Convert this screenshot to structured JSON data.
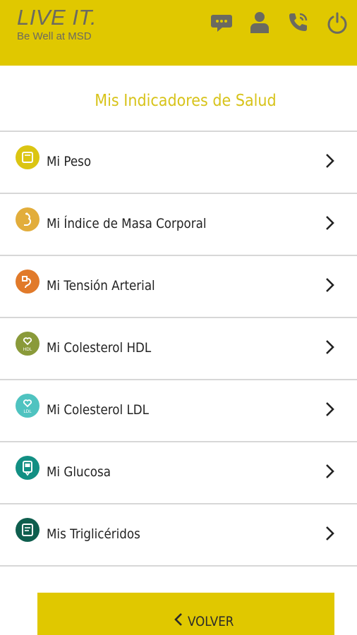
{
  "app": {
    "logo_main": "LIVE IT.",
    "logo_sub": "Be Well at MSD"
  },
  "header": {
    "icons": [
      "chat-icon",
      "profile-icon",
      "phone-icon",
      "power-icon"
    ]
  },
  "page": {
    "title": "Mis Indicadores de Salud"
  },
  "indicators": [
    {
      "label": "Mi Peso",
      "icon": "scale-icon",
      "color": "#dbc512"
    },
    {
      "label": "Mi Índice de Masa Corporal",
      "icon": "body-mass-icon",
      "color": "#e2ad3b"
    },
    {
      "label": "Mi Tensión Arterial",
      "icon": "blood-pressure-icon",
      "color": "#e17a2a"
    },
    {
      "label": "Mi Colesterol HDL",
      "icon": "cholesterol-hdl-icon",
      "badge_text": "HDL",
      "color": "#8a9a3a"
    },
    {
      "label": "Mi Colesterol LDL",
      "icon": "cholesterol-ldl-icon",
      "badge_text": "LDL",
      "color": "#4fc3c0"
    },
    {
      "label": "Mi Glucosa",
      "icon": "glucose-meter-icon",
      "color": "#128f83"
    },
    {
      "label": "Mis Triglicéridos",
      "icon": "triglycerides-icon",
      "color": "#0f5e4e"
    }
  ],
  "footer": {
    "back_label": "VOLVER"
  },
  "colors": {
    "brand_yellow": "#e0c800",
    "title_yellow": "#d7c31a",
    "header_icon": "#6b6a60",
    "divider": "#d7d7d7"
  }
}
